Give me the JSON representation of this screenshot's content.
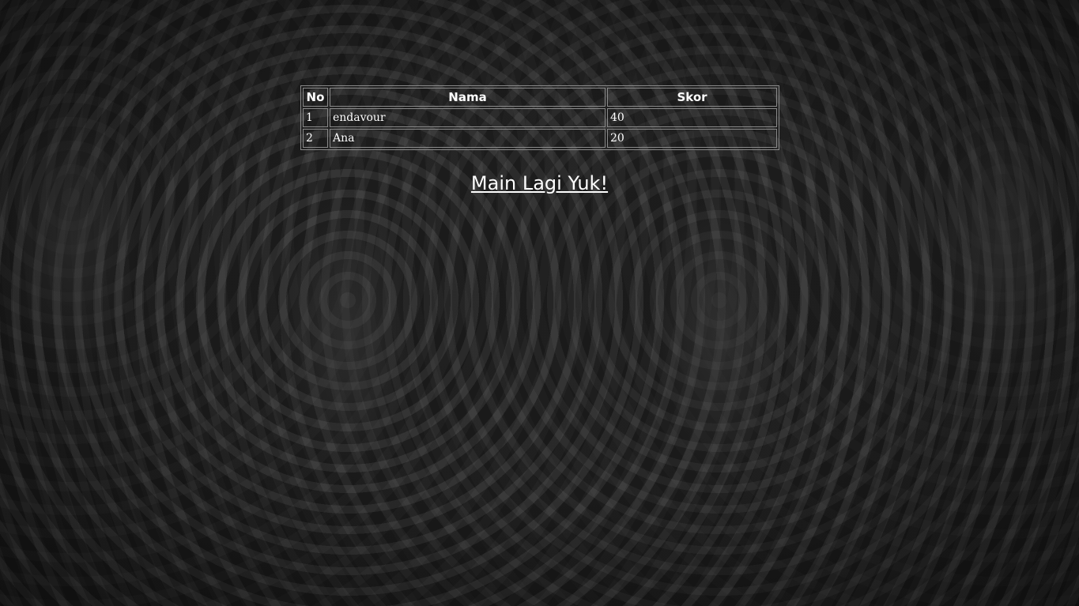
{
  "scoreboard": {
    "headers": {
      "no": "No",
      "nama": "Nama",
      "skor": "Skor"
    },
    "rows": [
      {
        "no": "1",
        "nama": "endavour",
        "skor": "40"
      },
      {
        "no": "2",
        "nama": "Ana",
        "skor": "20"
      }
    ]
  },
  "play_again_link": "Main Lagi Yuk!",
  "colors": {
    "text": "#ffffff",
    "background": "#232323",
    "table_border": "#8a8a8a"
  }
}
